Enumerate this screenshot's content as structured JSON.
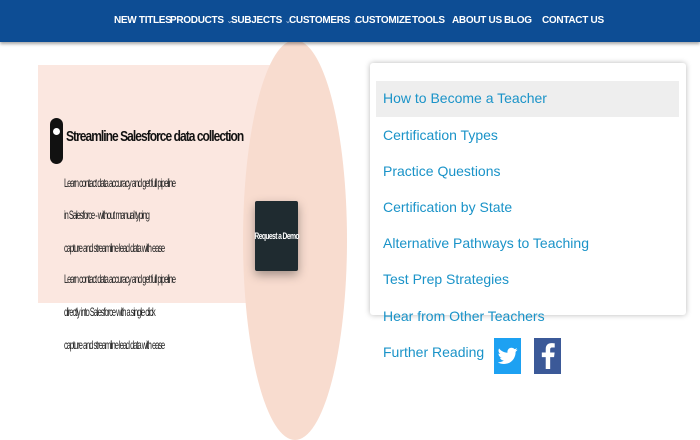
{
  "nav": {
    "items": [
      {
        "label": "NEW TITLES",
        "dropdown": false
      },
      {
        "label": "PRODUCTS",
        "dropdown": true
      },
      {
        "label": "SUBJECTS",
        "dropdown": true
      },
      {
        "label": "CUSTOMERS",
        "dropdown": true
      },
      {
        "label": "CUSTOMIZE",
        "dropdown": false
      },
      {
        "label": "TOOLS",
        "dropdown": false
      },
      {
        "label": "ABOUT US",
        "dropdown": false
      },
      {
        "label": "BLOG",
        "dropdown": false
      },
      {
        "label": "CONTACT US",
        "dropdown": false
      }
    ],
    "caret": "⌄"
  },
  "promo": {
    "heading": "Streamline Salesforce data collection",
    "lines": [
      "Learn contact data accuracy and get full pipeline",
      "in Salesforce - without manual typing",
      "capture and streamline lead data with ease",
      "Learn contact data accuracy and get full pipeline",
      "directly into Salesforce with a single click",
      "capture and streamline lead data with ease"
    ],
    "button_label": "Request a Demo"
  },
  "dropdown": {
    "items": [
      "How to Become a Teacher",
      "Certification Types",
      "Practice Questions",
      "Certification by State",
      "Alternative Pathways to Teaching",
      "Test Prep Strategies",
      "Hear from Other Teachers",
      "Further Reading"
    ],
    "highlighted_index": 0
  },
  "social": {
    "icons": [
      "twitter-icon",
      "facebook-icon"
    ],
    "colors": {
      "twitter": "#1da1f2",
      "facebook": "#3b5998"
    }
  },
  "colors": {
    "nav_background": "#0d4d94",
    "link": "#1a93c8",
    "promo_background": "#fbe7e0"
  }
}
